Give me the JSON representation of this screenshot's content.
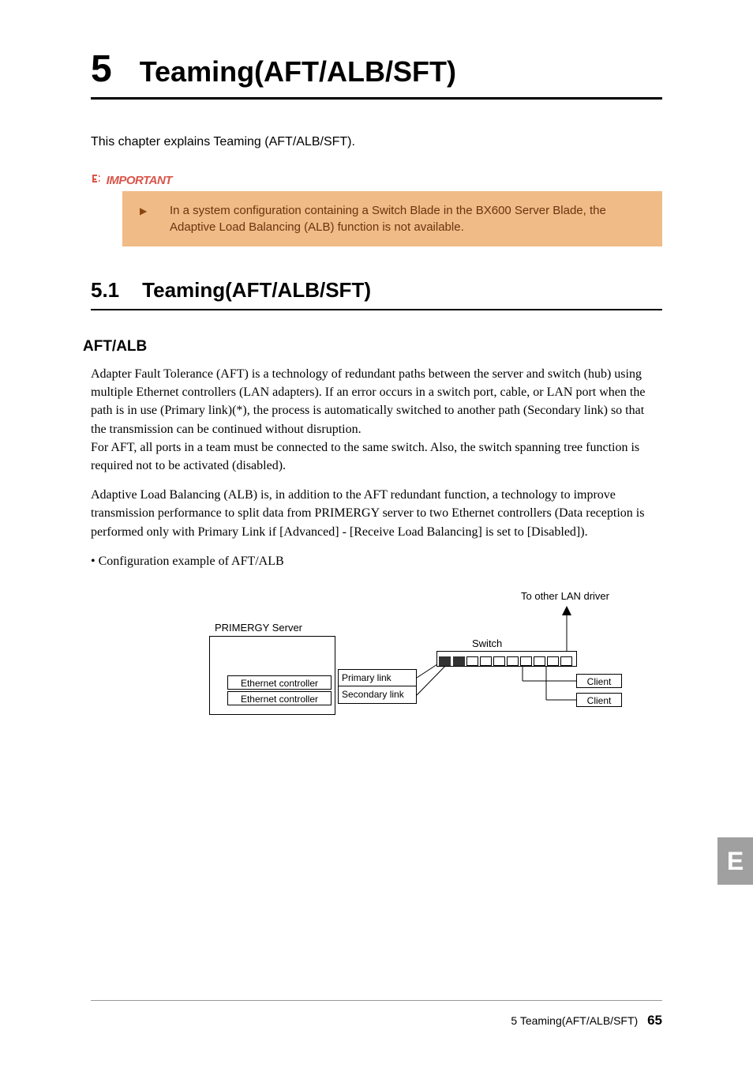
{
  "chapter": {
    "number": "5",
    "title": "Teaming(AFT/ALB/SFT)"
  },
  "intro": "This chapter explains Teaming (AFT/ALB/SFT).",
  "important": {
    "label": "IMPORTANT",
    "text": "In a system configuration containing a Switch Blade in the BX600 Server Blade, the Adaptive Load Balancing (ALB) function is not available."
  },
  "section": {
    "number": "5.1",
    "title": "Teaming(AFT/ALB/SFT)"
  },
  "subsection": {
    "title": "AFT/ALB"
  },
  "body": {
    "para1": "Adapter Fault Tolerance (AFT) is a technology of redundant paths between the server and switch (hub) using multiple Ethernet controllers (LAN adapters). If an error occurs in a switch port, cable, or LAN port when the path is in use (Primary link)(*), the process is automatically switched to another path (Secondary link) so that the transmission can be continued without disruption.",
    "para1b": "For AFT, all ports in a team must be connected to the same switch. Also, the switch spanning tree function is required not to be activated (disabled).",
    "para2": "Adaptive Load Balancing (ALB) is, in addition to the AFT redundant function, a technology to improve transmission performance to split data from PRIMERGY server to two Ethernet controllers (Data reception is performed only with Primary Link if [Advanced] - [Receive Load Balancing] is set to [Disabled]).",
    "bullet": "• Configuration example of AFT/ALB"
  },
  "diagram": {
    "top_label": "To other LAN driver",
    "server_label": "PRIMERGY Server",
    "eth1": "Ethernet controller",
    "eth2": "Ethernet controller",
    "primary": "Primary link",
    "secondary": "Secondary link",
    "switch": "Switch",
    "client1": "Client",
    "client2": "Client"
  },
  "side_tab": "E",
  "footer": {
    "text": "5 Teaming(AFT/ALB/SFT)",
    "page": "65"
  }
}
